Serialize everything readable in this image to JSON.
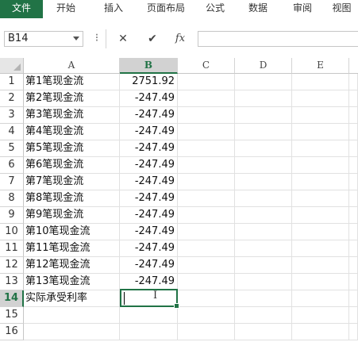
{
  "ribbon": {
    "tabs": [
      {
        "label": "文件",
        "active": true
      },
      {
        "label": "开始"
      },
      {
        "label": "插入"
      },
      {
        "label": "页面布局"
      },
      {
        "label": "公式"
      },
      {
        "label": "数据"
      },
      {
        "label": "审阅"
      },
      {
        "label": "视图"
      }
    ]
  },
  "formula_bar": {
    "name_box": "B14",
    "more_glyph": "⁝",
    "cancel_glyph": "✕",
    "confirm_glyph": "✔",
    "fx_label": "fx",
    "formula": ""
  },
  "grid": {
    "columns": [
      "A",
      "B",
      "C",
      "D",
      "E"
    ],
    "selected_column": "B",
    "rows": [
      {
        "num": "1",
        "a": "第1笔现金流",
        "b": "2751.92"
      },
      {
        "num": "2",
        "a": "第2笔现金流",
        "b": "-247.49"
      },
      {
        "num": "3",
        "a": "第3笔现金流",
        "b": "-247.49"
      },
      {
        "num": "4",
        "a": "第4笔现金流",
        "b": "-247.49"
      },
      {
        "num": "5",
        "a": "第5笔现金流",
        "b": "-247.49"
      },
      {
        "num": "6",
        "a": "第6笔现金流",
        "b": "-247.49"
      },
      {
        "num": "7",
        "a": "第7笔现金流",
        "b": "-247.49"
      },
      {
        "num": "8",
        "a": "第8笔现金流",
        "b": "-247.49"
      },
      {
        "num": "9",
        "a": "第9笔现金流",
        "b": "-247.49"
      },
      {
        "num": "10",
        "a": "第10笔现金流",
        "b": "-247.49"
      },
      {
        "num": "11",
        "a": "第11笔现金流",
        "b": "-247.49"
      },
      {
        "num": "12",
        "a": "第12笔现金流",
        "b": "-247.49"
      },
      {
        "num": "13",
        "a": "第13笔现金流",
        "b": "-247.49"
      },
      {
        "num": "14",
        "a": "实际承受利率",
        "b": ""
      },
      {
        "num": "15",
        "a": "",
        "b": ""
      },
      {
        "num": "16",
        "a": "",
        "b": ""
      }
    ],
    "active_cell": "B14",
    "accent_color": "#217346"
  }
}
